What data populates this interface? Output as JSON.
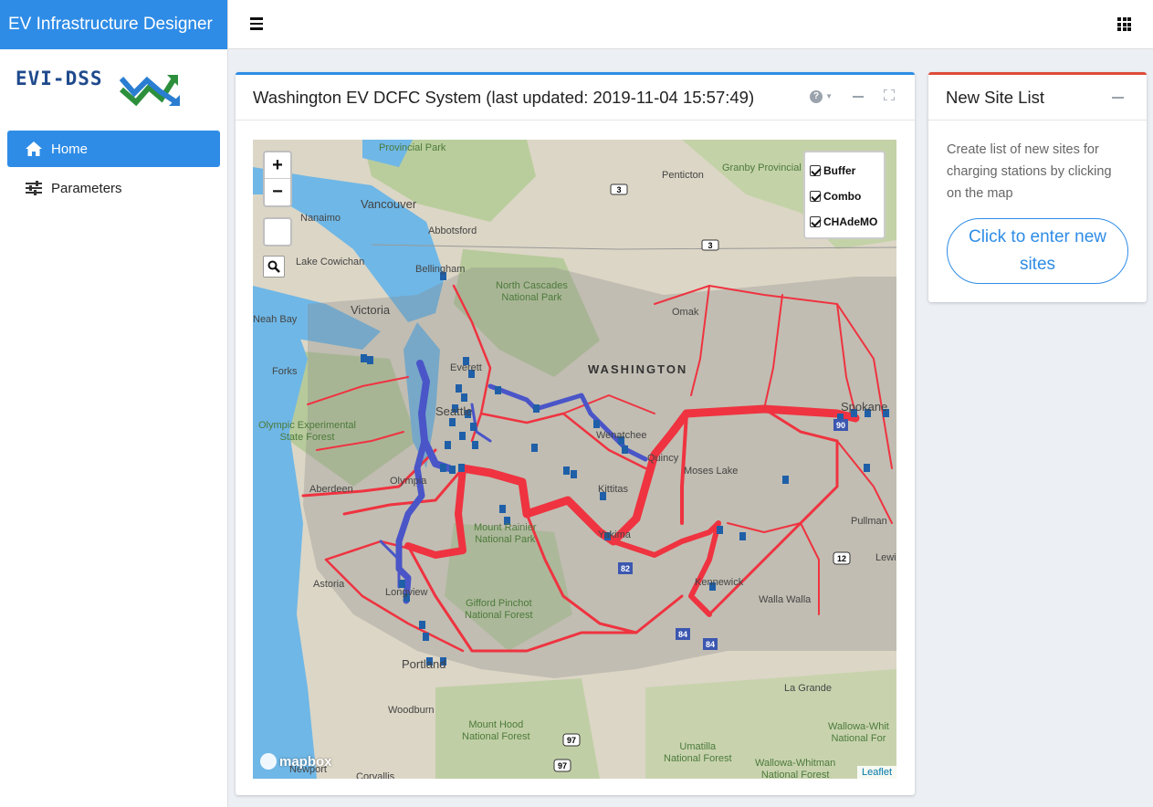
{
  "app": {
    "brand": "EV Infrastructure Designer",
    "logo_text": "EVI-DSS"
  },
  "sidebar": {
    "items": [
      {
        "label": "Home",
        "icon": "home-icon",
        "active": true
      },
      {
        "label": "Parameters",
        "icon": "sliders-icon",
        "active": false
      }
    ]
  },
  "main": {
    "title": "Washington EV DCFC System (last updated: 2019-11-04 15:57:49)",
    "map": {
      "zoom_in": "+",
      "zoom_out": "−",
      "legend": [
        "Buffer",
        "Combo",
        "CHAdeMO"
      ],
      "attribution": "Leaflet",
      "mapbox": "mapbox",
      "labels": {
        "provincial_park": "Provincial Park",
        "penticton": "Penticton",
        "granby": "Granby Provincial",
        "vancouver": "Vancouver",
        "nanaimo": "Nanaimo",
        "abbotsford": "Abbotsford",
        "lake_cowichan": "Lake Cowichan",
        "bellingham": "Bellingham",
        "north_cascades": "North Cascades\nNational Park",
        "victoria": "Victoria",
        "neah_bay": "Neah Bay",
        "omak": "Omak",
        "washington": "WASHINGTON",
        "forks": "Forks",
        "everett": "Everett",
        "seattle": "Seattle",
        "spokane": "Spokane",
        "olympic": "Olympic Experimental\nState Forest",
        "wenatchee": "Wenatchee",
        "quincy": "Quincy",
        "moses_lake": "Moses Lake",
        "aberdeen": "Aberdeen",
        "olympia": "Olympia",
        "kittitas": "Kittitas",
        "rainier": "Mount Rainier\nNational Park",
        "yakima": "Yakima",
        "pullman": "Pullman",
        "astoria": "Astoria",
        "kennewick": "Kennewick",
        "lewiston": "Lewiston",
        "longview": "Longview",
        "walla_walla": "Walla Walla",
        "gifford": "Gifford Pinchot\nNational Forest",
        "portland": "Portland",
        "la_grande": "La Grande",
        "woodburn": "Woodburn",
        "mt_hood": "Mount Hood\nNational Forest",
        "wallowa_whitman": "Wallowa-Whit\nNational For",
        "umatilla": "Umatilla\nNational Forest",
        "wallowa_whitman2": "Wallowa-Whitman\nNational Forest",
        "newport": "Newport",
        "corvallis": "Corvallis"
      },
      "shields": [
        "3",
        "3",
        "90",
        "90",
        "12",
        "12",
        "82",
        "84",
        "84",
        "97",
        "97"
      ]
    }
  },
  "side": {
    "title": "New Site List",
    "description": "Create list of new sites for charging stations by clicking on the map",
    "button": "Click to enter new sites"
  },
  "colors": {
    "primary": "#2e8ce6",
    "danger": "#dd4b39",
    "combo_route": "#ef3340",
    "chademo_route": "#4a55c8",
    "water": "#6fb7e6",
    "buffer": "#8a8a8a"
  }
}
